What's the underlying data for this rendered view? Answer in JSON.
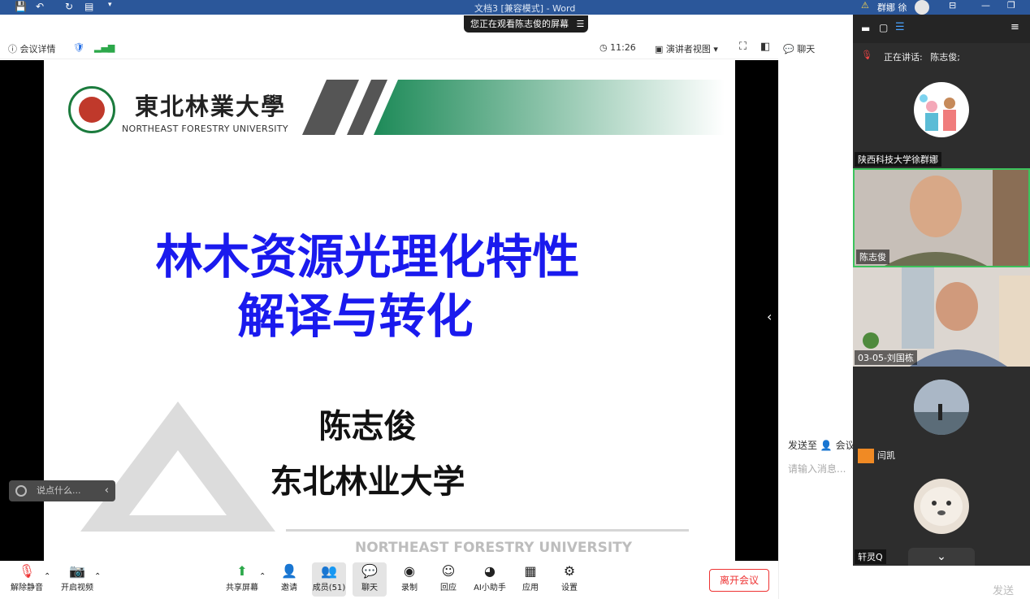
{
  "word": {
    "title": "文档3 [兼容模式] - Word",
    "user": "群娜 徐"
  },
  "banner": {
    "text": "您正在观看陈志俊的屏幕"
  },
  "topbar": {
    "details": "会议详情",
    "time": "11:26",
    "view": "演讲者视图",
    "chat_tab": "聊天"
  },
  "slide": {
    "logo_cn": "東北林業大學",
    "logo_en": "NORTHEAST FORESTRY UNIVERSITY",
    "title_line1": "林木资源光理化特性",
    "title_line2": "解译与转化",
    "speaker": "陈志俊",
    "university": "东北林业大学",
    "footer_en": "NORTHEAST FORESTRY UNIVERSITY"
  },
  "say_input": {
    "placeholder": "说点什么..."
  },
  "chat": {
    "send_to_label": "发送至",
    "send_to_target": "会议",
    "input_placeholder": "请输入消息...",
    "send_button": "发送"
  },
  "participants": {
    "speaking_label": "正在讲话:",
    "speaking_name": "陈志俊;",
    "list": [
      {
        "name": "陕西科技大学徐群娜"
      },
      {
        "name": "陈志俊"
      },
      {
        "name": "03-05-刘国栋"
      },
      {
        "name": "闫凯"
      },
      {
        "name": "轩灵Q"
      }
    ]
  },
  "toolbar": {
    "unmute": "解除静音",
    "start_video": "开启视频",
    "share": "共享屏幕",
    "invite": "邀请",
    "members": "成员(51)",
    "chat": "聊天",
    "record": "录制",
    "playback": "回应",
    "ai": "AI小助手",
    "apps": "应用",
    "settings": "设置",
    "leave": "离开会议"
  },
  "colors": {
    "title_blue": "#1a1aee",
    "word_blue": "#2b579a",
    "leave_red": "#e33333",
    "brand_green": "#1b7b3d"
  }
}
